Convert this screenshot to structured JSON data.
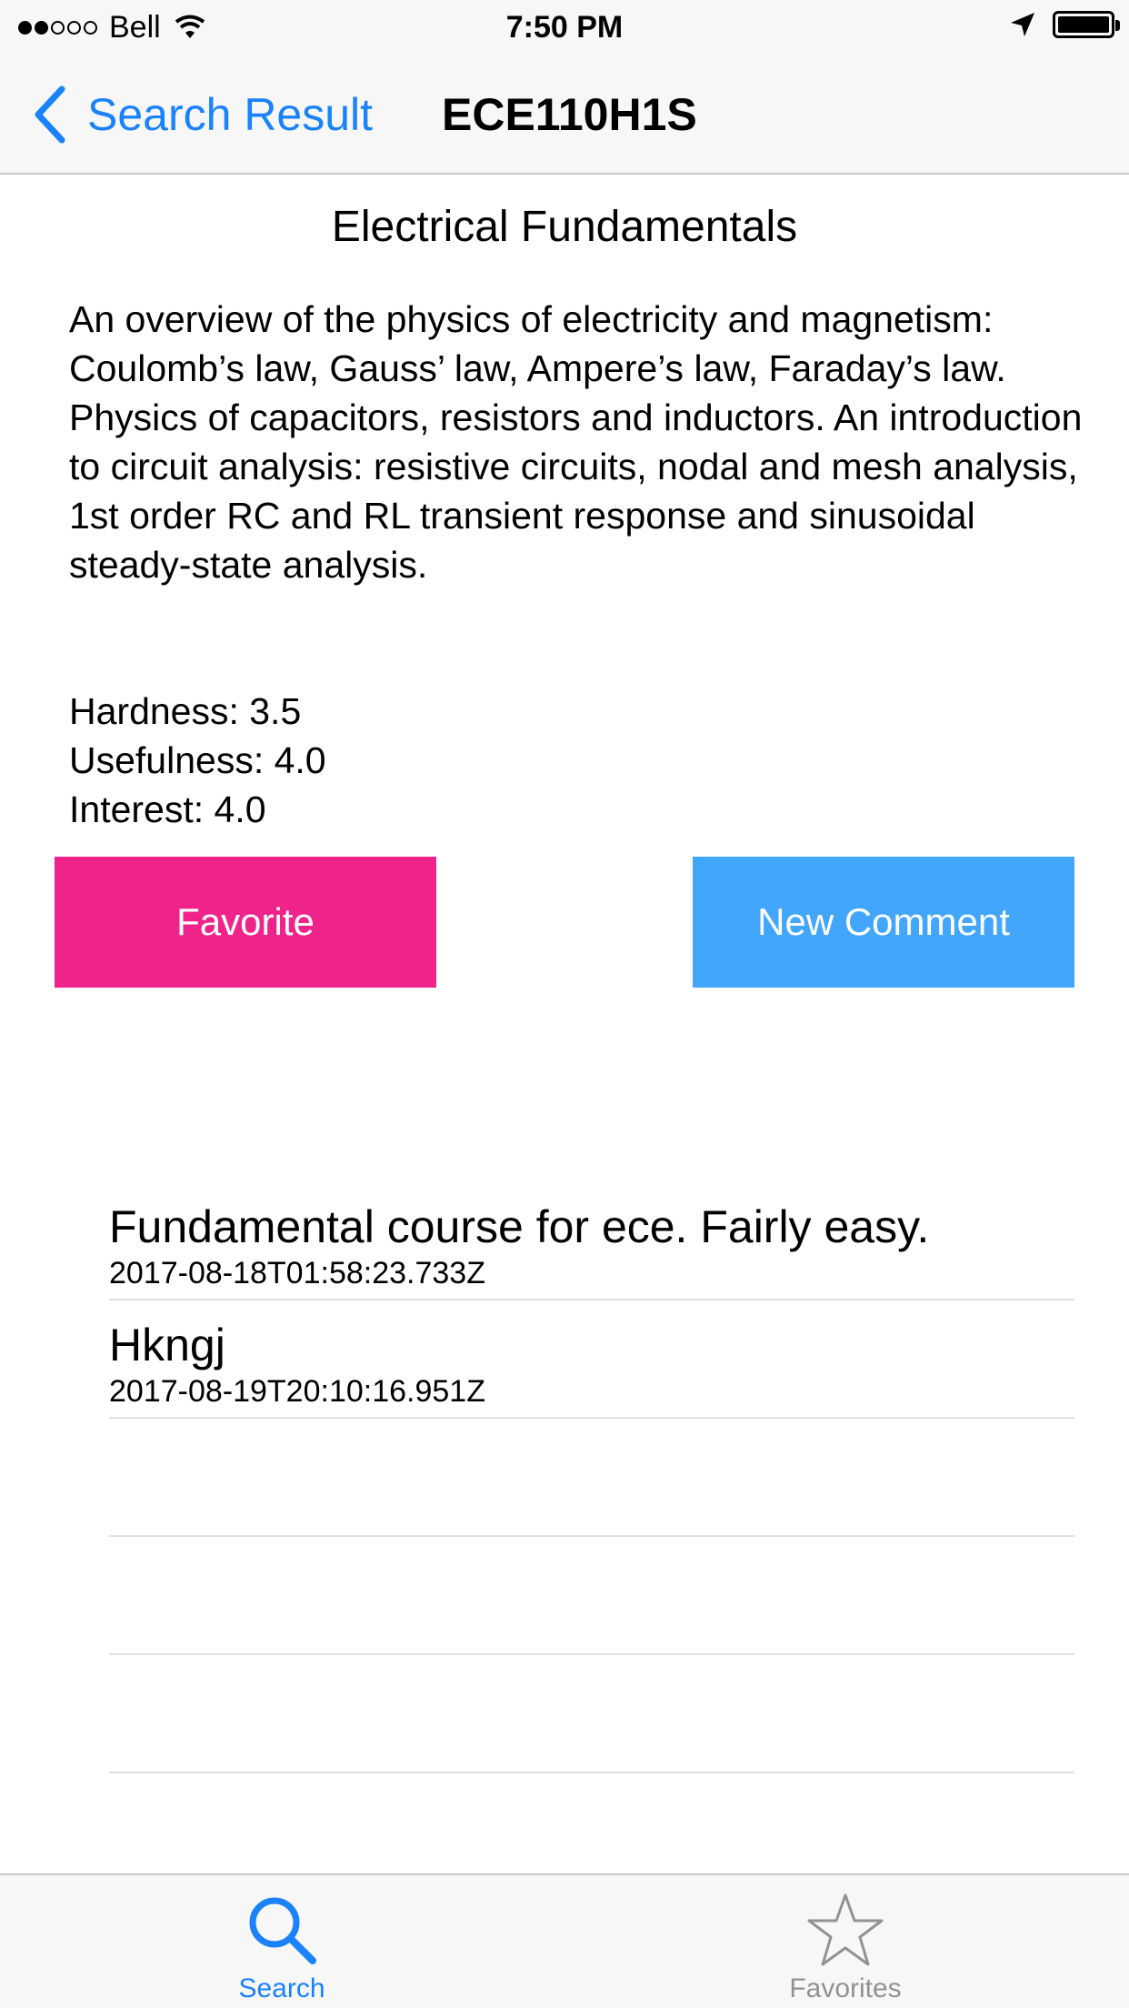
{
  "status_bar": {
    "carrier": "Bell",
    "time": "7:50 PM",
    "signal_filled": 2,
    "signal_total": 5,
    "battery_level": 1.0
  },
  "nav": {
    "back_label": "Search Result",
    "title": "ECE110H1S",
    "accent_color": "#1a82fb"
  },
  "course": {
    "name": "Electrical Fundamentals",
    "description": "An overview of the physics of electricity and magnetism: Coulomb’s law, Gauss’ law, Ampere’s law, Faraday’s law. Physics of capacitors, resistors and inductors.  An introduction to circuit analysis: resistive circuits, nodal and mesh analysis, 1st order RC and RL transient response and sinusoidal steady-state analysis.",
    "hardness": "Hardness: 3.5",
    "usefulness": "Usefulness: 4.0",
    "interest": "Interest: 4.0"
  },
  "actions": {
    "favorite_label": "Favorite",
    "favorite_color": "#f0238b",
    "comment_label": "New Comment",
    "comment_color": "#41a6fc"
  },
  "comments": [
    {
      "text": "Fundamental course for ece. Fairly easy.",
      "date": "2017-08-18T01:58:23.733Z"
    },
    {
      "text": "Hkngj",
      "date": "2017-08-19T20:10:16.951Z"
    },
    {
      "text": "",
      "date": ""
    },
    {
      "text": "",
      "date": ""
    },
    {
      "text": "",
      "date": ""
    }
  ],
  "tabs": [
    {
      "label": "Search",
      "icon": "search-icon",
      "selected": true
    },
    {
      "label": "Favorites",
      "icon": "star-icon",
      "selected": false
    }
  ]
}
